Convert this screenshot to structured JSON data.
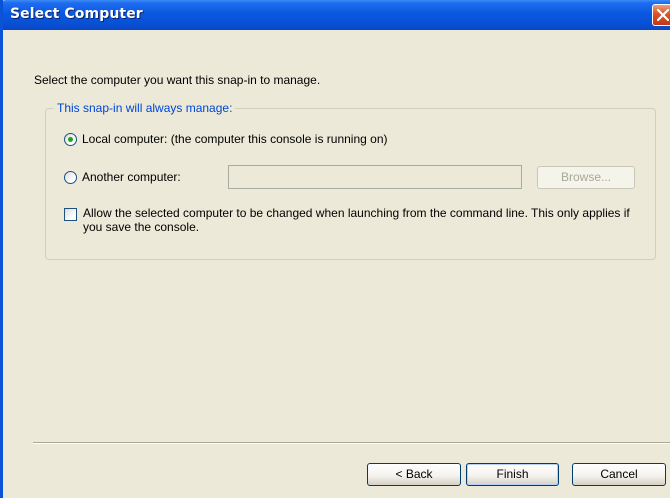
{
  "window": {
    "title": "Select Computer"
  },
  "intro_text": "Select the computer you want this snap-in to manage.",
  "group": {
    "legend": "This snap-in will always manage:",
    "local_computer_label": "Local computer:  (the computer this console is running on)",
    "local_computer_selected": true,
    "another_computer_label": "Another computer:",
    "another_computer_selected": false,
    "computer_name_value": "",
    "browse_label": "Browse...",
    "allow_change_label": "Allow the selected computer to be changed when launching from the command line.  This only applies if you save the console.",
    "allow_change_checked": false
  },
  "buttons": {
    "back_label": "< Back",
    "finish_label": "Finish",
    "cancel_label": "Cancel"
  },
  "colors": {
    "titlebar": "#0a58e0",
    "legend_text": "#0046d5",
    "radio_dot": "#21a121",
    "close_button": "#d8522a"
  },
  "icons": {
    "close": "close-icon"
  }
}
